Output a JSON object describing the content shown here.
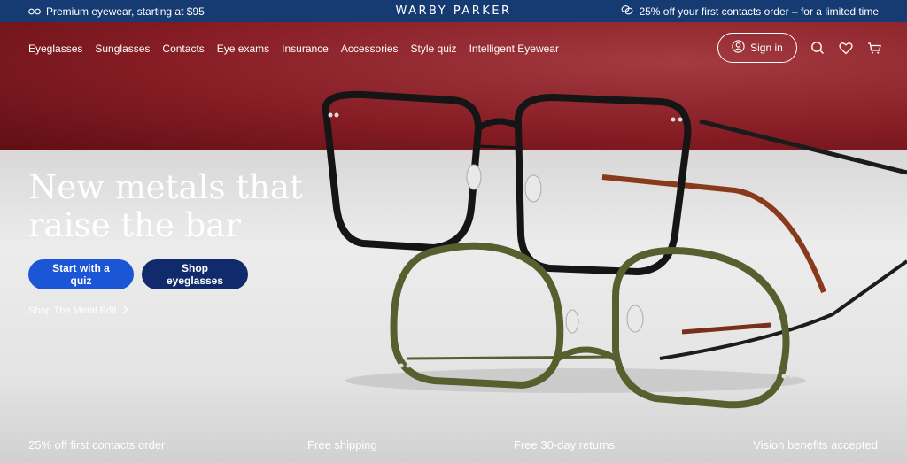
{
  "promo": {
    "left_text": "Premium eyewear, starting at $95",
    "brand": "WARBY PARKER",
    "right_text": "25% off your first contacts order – for a limited time"
  },
  "nav": {
    "items": [
      "Eyeglasses",
      "Sunglasses",
      "Contacts",
      "Eye exams",
      "Insurance",
      "Accessories",
      "Style quiz",
      "Intelligent Eyewear"
    ],
    "sign_in": "Sign in"
  },
  "hero": {
    "headline": "New metals that raise the bar",
    "primary_cta": "Start with a quiz",
    "secondary_cta": "Shop eyeglasses",
    "link": "Shop The Metal Edit"
  },
  "benefits": [
    "25% off first contacts order",
    "Free shipping",
    "Free 30-day returns",
    "Vision benefits accepted"
  ],
  "colors": {
    "promo_bg": "#163a72",
    "primary_button": "#1a56d6",
    "secondary_button": "#102a6b"
  }
}
